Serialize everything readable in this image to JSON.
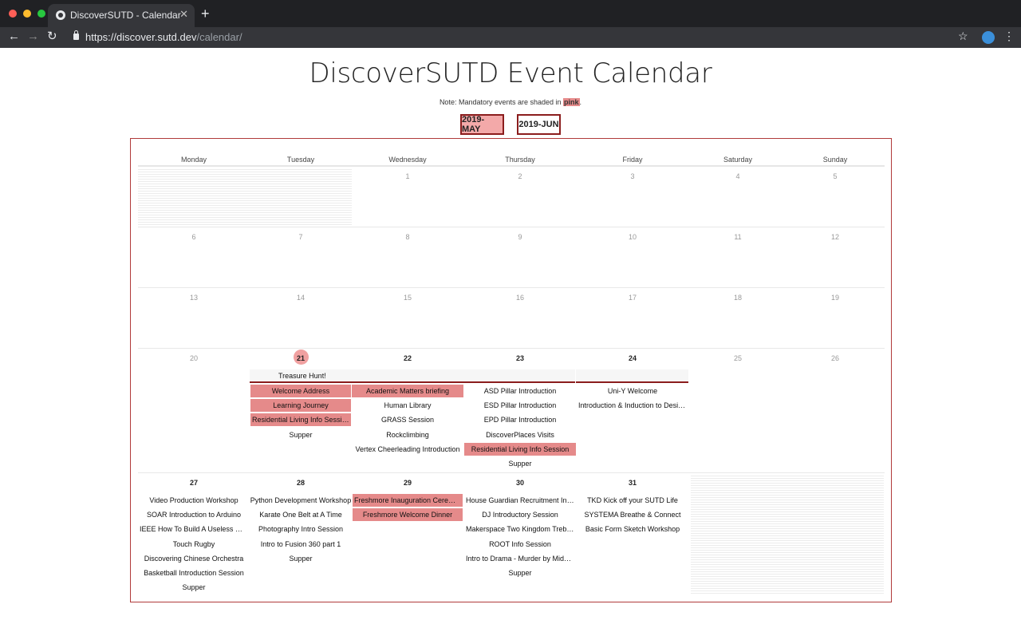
{
  "browser": {
    "tab_title": "DiscoverSUTD - Calendar",
    "url_host": "https://discover.sutd.dev",
    "url_path": "/calendar/",
    "close_glyph": "✕",
    "newtab_glyph": "+",
    "back_glyph": "←",
    "forward_glyph": "→",
    "reload_glyph": "↻",
    "star_glyph": "☆",
    "menu_glyph": "⋮",
    "light_colors": [
      "#ff5f57",
      "#febc2e",
      "#28c840"
    ]
  },
  "page": {
    "title": "DiscoverSUTD Event Calendar",
    "note_prefix": "Note: Mandatory events are shaded in ",
    "note_pink": "pink",
    "note_suffix": ".",
    "mandatory_color": "#e58a8a"
  },
  "months": [
    {
      "label": "2019-MAY",
      "active": true
    },
    {
      "label": "2019-JUN",
      "active": false
    }
  ],
  "weekdays": [
    "Monday",
    "Tuesday",
    "Wednesday",
    "Thursday",
    "Friday",
    "Saturday",
    "Sunday"
  ],
  "weeks": [
    [
      "",
      "",
      "1",
      "2",
      "3",
      "4",
      "5"
    ],
    [
      "6",
      "7",
      "8",
      "9",
      "10",
      "11",
      "12"
    ],
    [
      "13",
      "14",
      "15",
      "16",
      "17",
      "18",
      "19"
    ],
    [
      "20",
      "21",
      "22",
      "23",
      "24",
      "25",
      "26"
    ],
    [
      "27",
      "28",
      "29",
      "30",
      "31",
      "",
      ""
    ]
  ],
  "spanning_event": "Treasure Hunt!",
  "events": {
    "tue21": [
      {
        "label": "Welcome Address",
        "mandatory": true
      },
      {
        "label": "Learning Journey",
        "mandatory": true
      },
      {
        "label": "Residential Living Info Session",
        "mandatory": true
      },
      {
        "label": "Supper",
        "mandatory": false
      }
    ],
    "wed22": [
      {
        "label": "Academic Matters briefing",
        "mandatory": true
      },
      {
        "label": "Human Library",
        "mandatory": false
      },
      {
        "label": "GRASS Session",
        "mandatory": false
      },
      {
        "label": "Rockclimbing",
        "mandatory": false
      },
      {
        "label": "Vertex Cheerleading Introduction",
        "mandatory": false
      }
    ],
    "thu23": [
      {
        "label": "ASD Pillar Introduction",
        "mandatory": false
      },
      {
        "label": "ESD Pillar Introduction",
        "mandatory": false
      },
      {
        "label": "EPD Pillar Introduction",
        "mandatory": false
      },
      {
        "label": "DiscoverPlaces Visits",
        "mandatory": false
      },
      {
        "label": "Residential Living Info Session",
        "mandatory": true
      },
      {
        "label": "Supper",
        "mandatory": false
      }
    ],
    "fri24": [
      {
        "label": "Uni-Y Welcome",
        "mandatory": false
      },
      {
        "label": "Introduction & Induction to Desig…",
        "mandatory": false
      }
    ],
    "mon27": [
      {
        "label": "Video Production Workshop",
        "mandatory": false
      },
      {
        "label": "SOAR Introduction to Arduino",
        "mandatory": false
      },
      {
        "label": "IEEE How To Build A Useless Mac…",
        "mandatory": false
      },
      {
        "label": "Touch Rugby",
        "mandatory": false
      },
      {
        "label": "Discovering Chinese Orchestra",
        "mandatory": false
      },
      {
        "label": "Basketball Introduction Session",
        "mandatory": false
      },
      {
        "label": "Supper",
        "mandatory": false
      }
    ],
    "tue28": [
      {
        "label": "Python Development Workshop",
        "mandatory": false
      },
      {
        "label": "Karate One Belt at A Time",
        "mandatory": false
      },
      {
        "label": "Photography Intro Session",
        "mandatory": false
      },
      {
        "label": "Intro to Fusion 360 part 1",
        "mandatory": false
      },
      {
        "label": "Supper",
        "mandatory": false
      }
    ],
    "wed29": [
      {
        "label": "Freshmore Inauguration Ceremony",
        "mandatory": true
      },
      {
        "label": "Freshmore Welcome Dinner",
        "mandatory": true
      }
    ],
    "thu30": [
      {
        "label": "House Guardian Recruitment Inf…",
        "mandatory": false
      },
      {
        "label": "DJ Introductory Session",
        "mandatory": false
      },
      {
        "label": "Makerspace Two Kingdom Trebu…",
        "mandatory": false
      },
      {
        "label": "ROOT Info Session",
        "mandatory": false
      },
      {
        "label": "Intro to Drama - Murder by Midni…",
        "mandatory": false
      },
      {
        "label": "Supper",
        "mandatory": false
      }
    ],
    "fri31": [
      {
        "label": "TKD Kick off your SUTD Life",
        "mandatory": false
      },
      {
        "label": "SYSTEMA Breathe & Connect",
        "mandatory": false
      },
      {
        "label": "Basic Form Sketch Workshop",
        "mandatory": false
      }
    ]
  }
}
